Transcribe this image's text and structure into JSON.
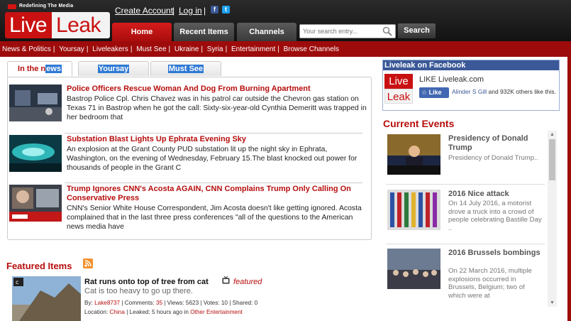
{
  "header": {
    "logo": {
      "tagline": "Redefining The Media",
      "word1": "Live",
      "word2": "Leak"
    },
    "links": {
      "create_account": "Create Account",
      "separator": "|",
      "login": "Log in"
    },
    "nav": [
      {
        "label": "Home"
      },
      {
        "label": "Recent Items"
      },
      {
        "label": "Channels"
      }
    ],
    "search": {
      "placeholder": "Your search entry...",
      "button": "Search"
    },
    "colors": {
      "accent": "#c91111",
      "bar": "#9e0b0b"
    }
  },
  "categories": [
    "News & Politics",
    "Yoursay",
    "Liveleakers",
    "Must See",
    "Ukraine",
    "Syria",
    "Entertainment",
    "Browse Channels"
  ],
  "tabs": [
    {
      "label_pre": "In the n",
      "label_hl": "ews"
    },
    {
      "label": "Yoursay"
    },
    {
      "label": "Must See"
    }
  ],
  "news": [
    {
      "title": "Police Officers Rescue Woman And Dog From Burning Apartment",
      "desc": "Bastrop Police Cpl. Chris Chavez was in his patrol car outside the Chevron gas station on Texas 71 in Bastrop when he got the call: Sixty-six-year-old Cynthia Demeritt was trapped in her bedroom that"
    },
    {
      "title": "Substation Blast Lights Up Ephrata Evening Sky",
      "desc": "An explosion at the Grant County PUD substation lit up the night sky in Ephrata, Washington, on the evening of Wednesday, February 15.The blast knocked out power for thousands of people in the Grant C"
    },
    {
      "title": "Trump Ignores CNN's Acosta AGAIN, CNN Complains Trump Only Calling On Conservative Press",
      "desc": "CNN's Senior White House Correspondent, Jim Acosta doesn't like getting ignored. Acosta complained that in the last three press conferences \"all of the questions to the American news media have"
    }
  ],
  "featured": {
    "heading": "Featured Items",
    "item": {
      "title": "Rat runs onto top of tree from cat",
      "flag": "featured",
      "desc": "Cat is too heavy to go up there.",
      "by_label": "By: ",
      "by": "Lake8737",
      "comments_label": " | Comments: ",
      "comments": "35",
      "views_label": " | Views: ",
      "views": "5623",
      "votes_label": " | Votes: ",
      "votes": "10",
      "shared_label": " | Shared: ",
      "shared": "0",
      "location_label": "Location: ",
      "location": "China",
      "leaked_label": " | Leaked: ",
      "leaked": "5 hours ago",
      "in_label": " in ",
      "channel": "Other Entertainment"
    }
  },
  "facebook": {
    "header": "Liveleak on Facebook",
    "logo_top": "Live",
    "logo_bottom": "Leak",
    "like_title": "LIKE Liveleak.com",
    "like_button": "Like",
    "name": "Alinder S Gill",
    "count_text": " and 932K others like this."
  },
  "current_events": {
    "heading": "Current Events",
    "items": [
      {
        "title": "Presidency of Donald Trump",
        "desc": "Presidency of Donald Trump.."
      },
      {
        "title": "2016 Nice attack",
        "desc": "On 14 July 2016, a motorist drove a truck into a crowd of people celebrating Bastille Day .."
      },
      {
        "title": "2016 Brussels bombings",
        "desc": "On 22 March 2016, multiple explosions occurred in Brussels, Belgium; two of which were at"
      }
    ]
  }
}
